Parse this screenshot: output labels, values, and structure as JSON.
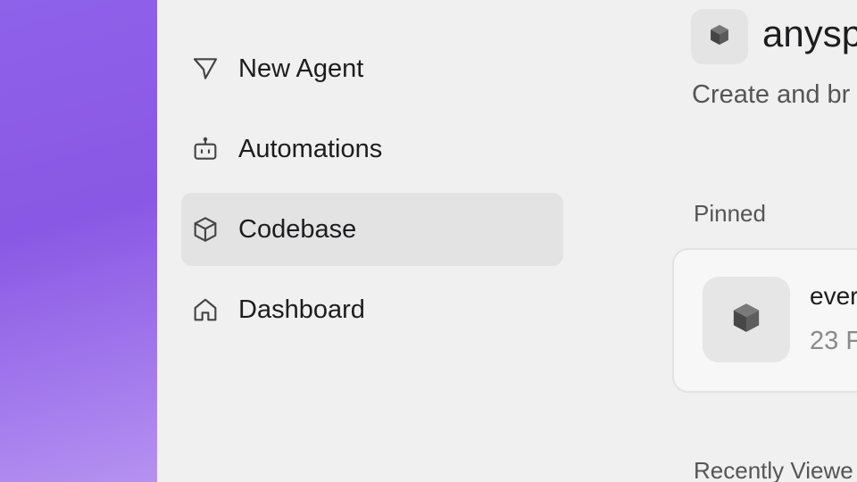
{
  "sidebar": {
    "items": [
      {
        "label": "New Agent",
        "icon": "send-icon",
        "active": false
      },
      {
        "label": "Automations",
        "icon": "robot-icon",
        "active": false
      },
      {
        "label": "Codebase",
        "icon": "cube-icon",
        "active": true
      },
      {
        "label": "Dashboard",
        "icon": "home-icon",
        "active": false
      }
    ]
  },
  "main": {
    "repo_name": "anysp",
    "subtitle": "Create and br",
    "pinned_label": "Pinned",
    "pinned_card": {
      "title": "ever",
      "meta": "23 F"
    },
    "recent_label": "Recently Viewe"
  },
  "colors": {
    "accent": "#8958e4",
    "active_bg": "#e3e3e3",
    "text": "#1d1d1f"
  }
}
